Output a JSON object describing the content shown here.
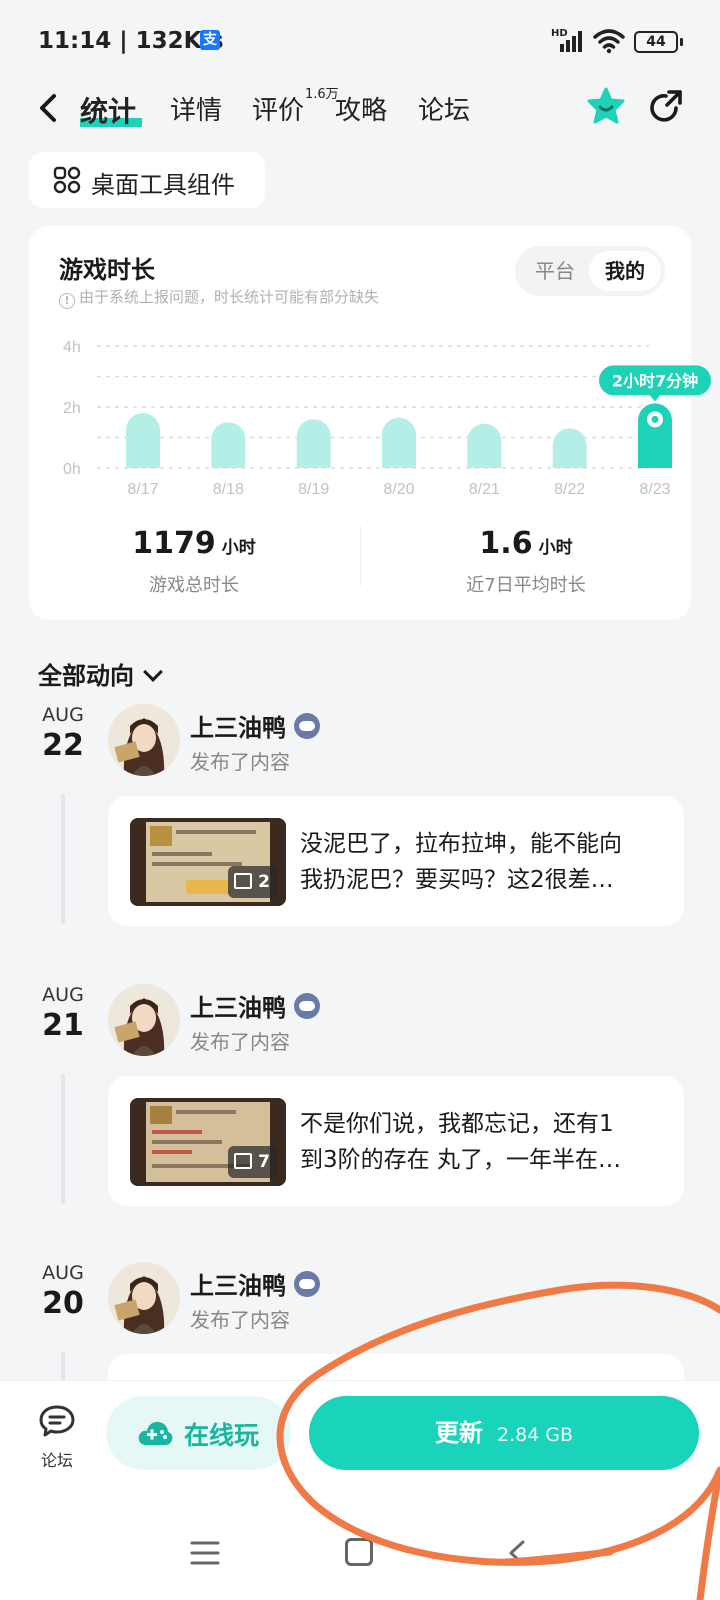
{
  "status_bar": {
    "time": "11:14 | 132K/s",
    "alipay_glyph": "支",
    "network_label": "HD",
    "battery": "44"
  },
  "nav": {
    "tabs": [
      {
        "label": "统计",
        "active": true
      },
      {
        "label": "详情"
      },
      {
        "label": "评价",
        "badge": "1.6万"
      },
      {
        "label": "攻略"
      },
      {
        "label": "论坛"
      }
    ],
    "icons": [
      "back-icon",
      "star-icon",
      "share-icon"
    ]
  },
  "widget_button": {
    "label": "桌面工具组件",
    "icon": "grid-icon"
  },
  "playtime": {
    "title": "游戏时长",
    "note": "由于系统上报问题，时长统计可能有部分缺失",
    "note_icon": "!",
    "toggle": [
      "平台",
      "我的"
    ],
    "selected_toggle": "我的",
    "stats": [
      {
        "value": "1179",
        "unit": "小时",
        "label": "游戏总时长"
      },
      {
        "value": "1.6",
        "unit": "小时",
        "label": "近7日平均时长"
      }
    ]
  },
  "chart_data": {
    "type": "bar",
    "categories": [
      "8/17",
      "8/18",
      "8/19",
      "8/20",
      "8/21",
      "8/22",
      "8/23"
    ],
    "values": [
      1.8,
      1.5,
      1.6,
      1.65,
      1.45,
      1.3,
      2.12
    ],
    "y_ticks": [
      "0h",
      "2h",
      "4h"
    ],
    "ylim": [
      0,
      4
    ],
    "highlight_index": 6,
    "highlight_label": "2小时7分钟",
    "grid": true,
    "colors": {
      "bar": "#b3efe7",
      "highlight": "#1ed2b8",
      "grid": "#dcdcdc",
      "tick": "#c2c2c2"
    }
  },
  "feed": {
    "header": "全部动向",
    "items": [
      {
        "month": "AUG",
        "day": "22",
        "author": "上三油鸭",
        "action": "发布了内容",
        "text_line1": "没泥巴了，拉布拉坤，能不能向",
        "text_line2": "我扔泥巴？要买吗？这2很差…",
        "image_count": "2"
      },
      {
        "month": "AUG",
        "day": "21",
        "author": "上三油鸭",
        "action": "发布了内容",
        "text_line1": "不是你们说，我都忘记，还有1",
        "text_line2": "到3阶的存在 丸了，一年半在…",
        "image_count": "7"
      },
      {
        "month": "AUG",
        "day": "20",
        "author": "上三油鸭",
        "action": "发布了内容"
      }
    ]
  },
  "bottom_bar": {
    "forum_label": "论坛",
    "play_online_label": "在线玩",
    "update_label": "更新",
    "update_size": "2.84 GB"
  },
  "colors": {
    "accent": "#1ed2b8",
    "annotation": "#f07a45"
  }
}
